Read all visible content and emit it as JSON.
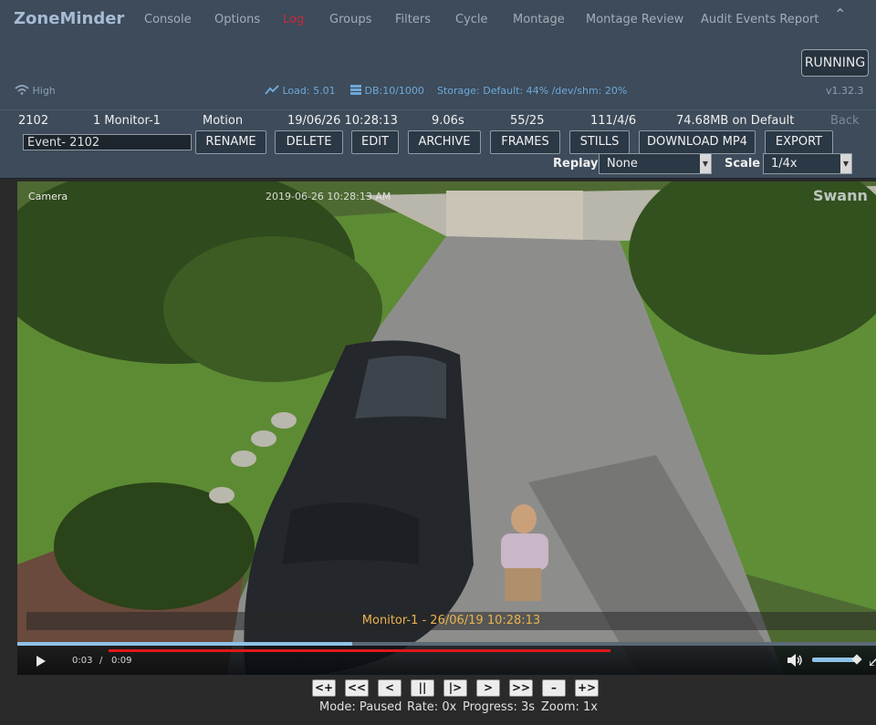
{
  "header": {
    "brand": "ZoneMinder",
    "nav": [
      "Console",
      "Options",
      "Log",
      "Groups",
      "Filters",
      "Cycle",
      "Montage",
      "Montage Review",
      "Audit Events Report"
    ],
    "active_nav": "Log",
    "run_state": "RUNNING",
    "signal": "High",
    "load": "Load: 5.01",
    "db": "DB:10/1000",
    "storage": "Storage: Default: 44% /dev/shm: 20%",
    "version": "v1.32.3"
  },
  "event": {
    "id": "2102",
    "monitor": "1 Monitor-1",
    "cause": "Motion",
    "datetime": "19/06/26 10:28:13",
    "duration": "9.06s",
    "frames": "55/25",
    "scores": "111/4/6",
    "size": "74.68MB on Default",
    "back": "Back",
    "name_value": "Event- 2102"
  },
  "actions": [
    "RENAME",
    "DELETE",
    "EDIT",
    "ARCHIVE",
    "FRAMES",
    "STILLS",
    "DOWNLOAD MP4",
    "EXPORT"
  ],
  "replay": {
    "label": "Replay",
    "value": "None"
  },
  "scale": {
    "label": "Scale",
    "value": "1/4x"
  },
  "video": {
    "camera_label": "Camera",
    "camera_time": "2019-06-26 10:28:13 AM",
    "camera_brand": "Swann",
    "overlay": "Monitor-1 - 26/06/19 10:28:13",
    "current_time": "0:03",
    "separator": "/",
    "total_time": "0:09",
    "progress_fraction": 0.39,
    "volume_fraction": 0.9
  },
  "playback_buttons": [
    "<+",
    "<<",
    "<",
    "||",
    "|>",
    ">",
    ">>",
    "–",
    "+>"
  ],
  "status": {
    "mode": "Mode: Paused",
    "rate": "Rate: 0x",
    "progress": "Progress: 3s",
    "zoom": "Zoom: 1x"
  }
}
